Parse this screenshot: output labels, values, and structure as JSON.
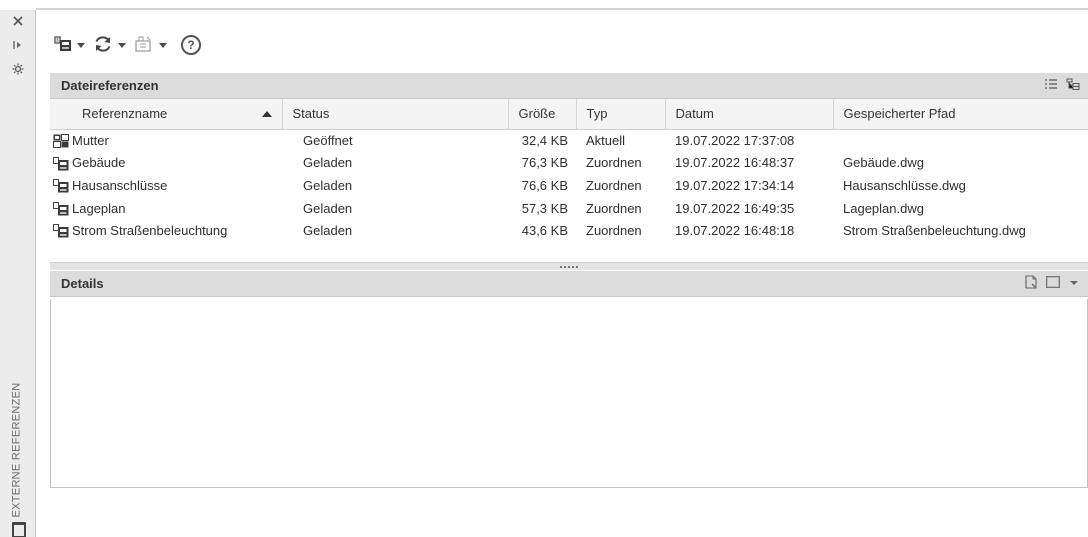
{
  "palette": {
    "title": "EXTERNE REFERENZEN",
    "close_icon": "close-icon",
    "autohide_icon": "autohide-icon",
    "properties_icon": "properties-icon"
  },
  "toolbar": {
    "attach_icon": "attach-dwg-icon",
    "refresh_icon": "refresh-icon",
    "change_path_icon": "change-path-icon",
    "help_glyph": "?"
  },
  "file_references": {
    "title": "Dateireferenzen",
    "columns": [
      "Referenzname",
      "Status",
      "Größe",
      "Typ",
      "Datum",
      "Gespeicherter Pfad"
    ],
    "sort_column": "Referenzname",
    "sort_direction": "ascending",
    "rows": [
      {
        "name": "Mutter",
        "status": "Geöffnet",
        "size": "32,4 KB",
        "type": "Aktuell",
        "date": "19.07.2022 17:37:08",
        "path": "",
        "icon": "master-drawing-icon"
      },
      {
        "name": "Gebäude",
        "status": "Geladen",
        "size": "76,3 KB",
        "type": "Zuordnen",
        "date": "19.07.2022 16:48:37",
        "path": "Gebäude.dwg",
        "icon": "dwg-reference-icon"
      },
      {
        "name": "Hausanschlüsse",
        "status": "Geladen",
        "size": "76,6 KB",
        "type": "Zuordnen",
        "date": "19.07.2022 17:34:14",
        "path": "Hausanschlüsse.dwg",
        "icon": "dwg-reference-icon"
      },
      {
        "name": "Lageplan",
        "status": "Geladen",
        "size": "57,3 KB",
        "type": "Zuordnen",
        "date": "19.07.2022 16:49:35",
        "path": "Lageplan.dwg",
        "icon": "dwg-reference-icon"
      },
      {
        "name": "Strom Straßenbeleuchtung",
        "status": "Geladen",
        "size": "43,6 KB",
        "type": "Zuordnen",
        "date": "19.07.2022 16:48:18",
        "path": "Strom Straßenbeleuchtung.dwg",
        "icon": "dwg-reference-icon"
      }
    ],
    "view_icons": [
      "list-view-icon",
      "tree-view-icon"
    ]
  },
  "details": {
    "title": "Details",
    "view_icons": [
      "details-icon",
      "preview-icon"
    ]
  }
}
